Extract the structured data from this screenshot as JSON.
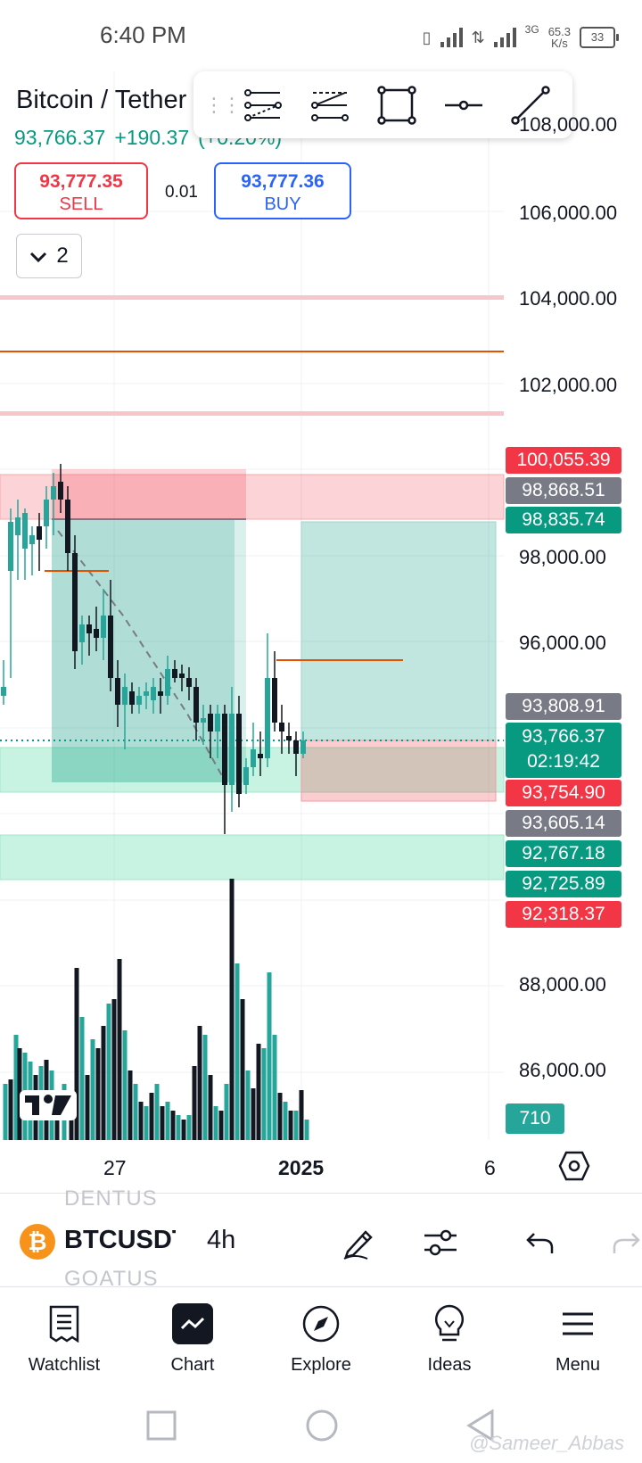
{
  "status_bar": {
    "time": "6:40 PM",
    "network_type": "3G",
    "net_speed_value": "65.3",
    "net_speed_unit": "K/s",
    "battery": "33"
  },
  "symbol": {
    "title": "Bitcoin / Tether",
    "last_price": "93,766.37",
    "change": "+190.37",
    "change_pct": "(+0.20%)"
  },
  "trade": {
    "sell_price": "93,777.35",
    "sell_label": "SELL",
    "spread": "0.01",
    "buy_price": "93,777.36",
    "buy_label": "BUY"
  },
  "indicator_collapse": {
    "count": "2"
  },
  "drawing_toolbar": {
    "tools": [
      "fib-retracement-tool",
      "parallel-channel-tool",
      "rectangle-tool",
      "horizontal-ray-tool",
      "trend-line-tool"
    ]
  },
  "price_axis": {
    "labels": [
      "108,000.00",
      "106,000.00",
      "104,000.00",
      "102,000.00",
      "98,000.00",
      "96,000.00",
      "88,000.00",
      "86,000.00"
    ]
  },
  "price_tags": {
    "t1": "100,055.39",
    "t2": "98,868.51",
    "t3": "98,835.74",
    "t4": "93,808.91",
    "last": "93,766.37",
    "countdown": "02:19:42",
    "t5": "93,754.90",
    "t6": "93,605.14",
    "t7": "92,767.18",
    "t8": "92,725.89",
    "t9": "92,318.37",
    "volume": "710"
  },
  "time_axis": {
    "labels": [
      "27",
      "2025",
      "6"
    ]
  },
  "colors": {
    "up": "#26a69a",
    "down": "#131722",
    "red_zone": "#f23645",
    "green_zone": "#089981",
    "accent_blue": "#2962ff",
    "orange_line": "#e65100"
  },
  "bottom_toolbar": {
    "ghost_above": "DENTUS",
    "symbol": "BTCUSDT",
    "interval": "4h",
    "ghost_below": "GOATUS"
  },
  "bottom_nav": {
    "items": [
      {
        "label": "Watchlist",
        "icon": "watchlist-icon"
      },
      {
        "label": "Chart",
        "icon": "chart-icon"
      },
      {
        "label": "Explore",
        "icon": "compass-icon"
      },
      {
        "label": "Ideas",
        "icon": "lightbulb-icon"
      },
      {
        "label": "Menu",
        "icon": "menu-icon"
      }
    ]
  },
  "watermark": "@Sameer_Abbas"
}
